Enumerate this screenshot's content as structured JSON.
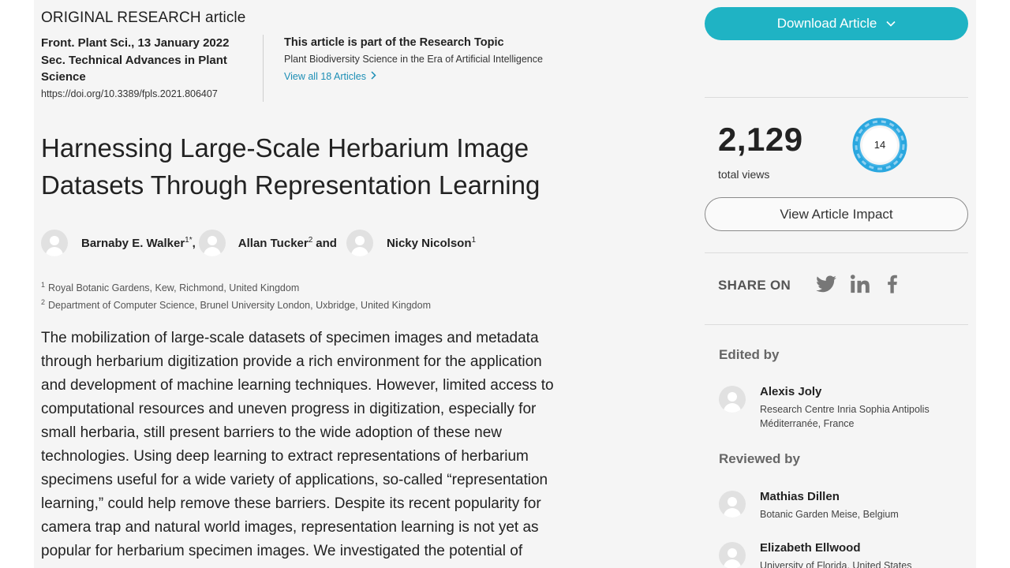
{
  "article": {
    "type_label": "ORIGINAL RESEARCH article",
    "journal_line": "Front. Plant Sci., 13 January 2022",
    "section_line1": "Sec. Technical Advances in Plant",
    "section_line2": "Science",
    "doi": "https://doi.org/10.3389/fpls.2021.806407",
    "title_line1": "Harnessing Large-Scale Herbarium Image",
    "title_line2": "Datasets Through Representation Learning",
    "authors": [
      {
        "name": "Barnaby E. Walker",
        "sup": "1*",
        "after": ","
      },
      {
        "name": "Allan Tucker",
        "sup": "2",
        "after": "and"
      },
      {
        "name": "Nicky Nicolson",
        "sup": "1",
        "after": ""
      }
    ],
    "affiliations": [
      {
        "num": "1",
        "text": "Royal Botanic Gardens, Kew, Richmond, United Kingdom"
      },
      {
        "num": "2",
        "text": "Department of Computer Science, Brunel University London, Uxbridge, United Kingdom"
      }
    ],
    "abstract_lines": [
      "The mobilization of large-scale datasets of specimen images and metadata",
      "through herbarium digitization provide a rich environment for the application",
      "and development of machine learning techniques. However, limited access to",
      "computational resources and uneven progress in digitization, especially for",
      "small herbaria, still present barriers to the wide adoption of these new",
      "technologies. Using deep learning to extract representations of herbarium",
      "specimens useful for a wide variety of applications, so-called “representation",
      "learning,” could help remove these barriers. Despite its recent popularity for",
      "camera trap and natural world images, representation learning is not yet as",
      "popular for herbarium specimen images. We investigated the potential of"
    ]
  },
  "research_topic": {
    "heading": "This article is part of the Research Topic",
    "name": "Plant Biodiversity Science in the Era of Artificial Intelligence",
    "link_label": "View all 18 Articles"
  },
  "sidebar": {
    "download_label": "Download Article",
    "views_count": "2,129",
    "views_label": "total views",
    "badge_score": "14",
    "impact_label": "View Article Impact",
    "share_label": "SHARE ON",
    "social": [
      "twitter-icon",
      "linkedin-icon",
      "facebook-icon"
    ],
    "edited_by_label": "Edited by",
    "editor": {
      "name": "Alexis Joly",
      "aff_line1": "Research Centre Inria Sophia Antipolis",
      "aff_line2": "Méditerranée, France"
    },
    "reviewed_by_label": "Reviewed by",
    "reviewers": [
      {
        "name": "Mathias Dillen",
        "aff": "Botanic Garden Meise, Belgium"
      },
      {
        "name": "Elizabeth Ellwood",
        "aff": "University of Florida, United States"
      }
    ]
  },
  "colors": {
    "accent": "#1fb3c4",
    "link": "#1c8eb5",
    "page_bg": "#f5f5f5",
    "social_icon": "#777777"
  }
}
